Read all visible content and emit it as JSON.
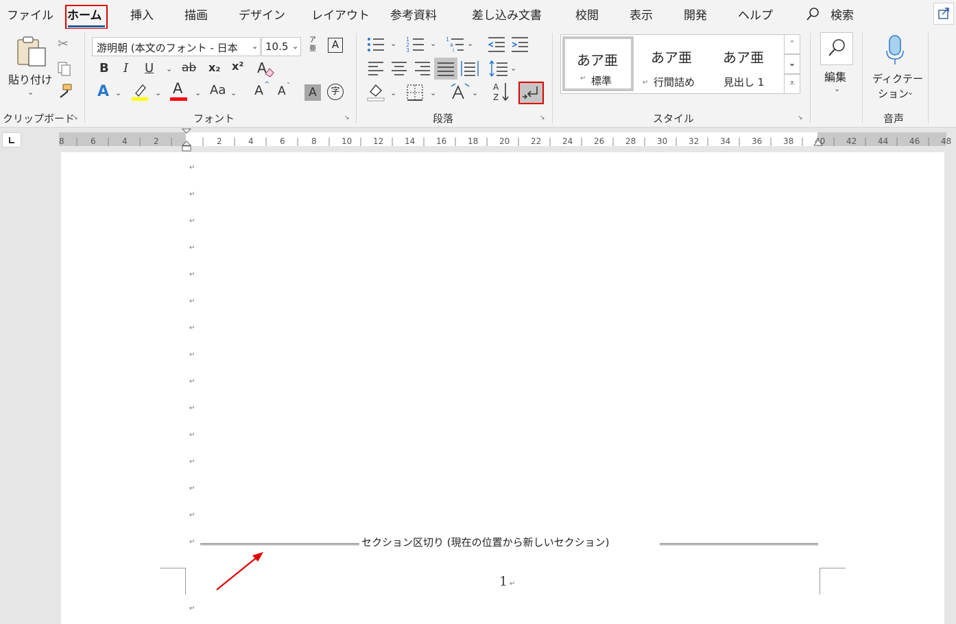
{
  "menu": {
    "file": "ファイル",
    "tabs": [
      "ホーム",
      "挿入",
      "描画",
      "デザイン",
      "レイアウト",
      "参考資料",
      "差し込み文書",
      "校閲",
      "表示",
      "開発",
      "ヘルプ"
    ],
    "search": "検索"
  },
  "clipboard": {
    "paste_label": "貼り付け",
    "group_label": "クリップボード"
  },
  "font": {
    "font_name": "游明朝 (本文のフォント - 日本",
    "font_size": "10.5",
    "group_label": "フォント",
    "phonetic_top": "ア",
    "phonetic_bottom": "亜",
    "bold": "B",
    "italic": "I",
    "underline": "U",
    "strike": "ab",
    "subscript": "x₂",
    "superscript": "x²",
    "change_case": "Aa",
    "text_effect": "A",
    "font_color": "A",
    "grow": "A",
    "shrink": "A",
    "shade": "A",
    "enclose": "字"
  },
  "paragraph": {
    "group_label": "段落"
  },
  "styles": {
    "group_label": "スタイル",
    "items": [
      {
        "preview": "あア亜",
        "name": "標準"
      },
      {
        "preview": "あア亜",
        "name": "行間詰め"
      },
      {
        "preview": "あア亜",
        "name": "見出し 1"
      }
    ]
  },
  "editing": {
    "label": "編集"
  },
  "voice": {
    "dictation_line1": "ディクテー",
    "dictation_line2": "ション",
    "group_label": "音声"
  },
  "ruler": {
    "ticks": [
      "8",
      "6",
      "4",
      "2",
      "",
      "2",
      "4",
      "6",
      "8",
      "10",
      "12",
      "14",
      "16",
      "18",
      "20",
      "22",
      "24",
      "26",
      "28",
      "30",
      "32",
      "34",
      "36",
      "38",
      "40",
      "42",
      "44",
      "46",
      "48"
    ]
  },
  "document": {
    "paragraph_mark": "↵",
    "section_break": "セクション区切り (現在の位置から新しいセクション)",
    "page_number": "1"
  },
  "colors": {
    "highlight_box": "#e00000",
    "tab_underline": "#2b579a",
    "arrow": "#e00000",
    "highlight_yellow": "#ffff00",
    "font_red": "#ff0000"
  }
}
